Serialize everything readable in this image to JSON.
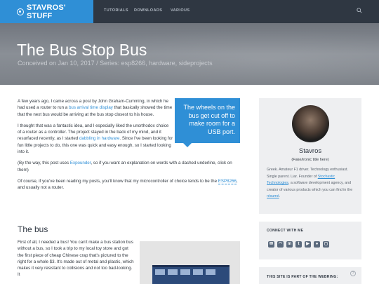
{
  "nav": {
    "brand": "STAVROS' STUFF",
    "items": [
      "TUTORIALS",
      "DOWNLOADS",
      "VARIOUS"
    ]
  },
  "hero": {
    "title": "The Bus Stop Bus",
    "subtitle": "Conceived on Jan 10, 2017 / Series: esp8266, hardware, sideprojects"
  },
  "pullquote": "The wheels on the bus get cut off to make room for a USB port.",
  "article": {
    "p1_a": "A few years ago, I came across a post by John Graham-Cumming, in which he had used a router to run a ",
    "p1_link": "bus arrival time display",
    "p1_b": " that basically showed the time that the next bus would be arriving at the bus stop closest to his house.",
    "p2_a": "I thought that was a fantastic idea, and I especially liked the unorthodox choice of a router as a controller. The project stayed in the back of my mind, and it resurfaced recently, as I started ",
    "p2_link": "dabbling in hardware",
    "p2_b": ". Since I've been looking for fun little projects to do, this one was quick and easy enough, so I started looking into it.",
    "p3_a": "(By the way, this post uses ",
    "p3_link": "Expounder",
    "p3_b": ", so if you want an explanation on words with a dashed underline, click on them)",
    "p4_a": "Of course, if you've been reading my posts, you'll know that my microcontroller of choice tends to be the ",
    "p4_term": "ESP8266",
    "p4_b": ", and usually not a router.",
    "h_bus": "The bus",
    "p5": "First of all, I needed a bus! You can't make a bus station bus without a bus, so I took a trip to my local toy store and got the first piece of cheap Chinese crap that's pictured to the right for a whole $3. It's made out of metal and plastic, which makes it very resistant to collisions and not too bad-looking. It"
  },
  "sidebar": {
    "author_name": "Stavros",
    "author_tag": "(Fake/ironic title here)",
    "bio_a": "Greek. Amateur F1 driver. Technology enthusiast. Single parent. Liar. Founder of ",
    "bio_link": "Stochastic Technologies",
    "bio_b": ", a software development agency, and creator of various products which you can find in the ",
    "bio_link2": "résumé",
    "bio_c": "."
  },
  "connect": {
    "title": "CONNECT WITH ME",
    "icons": [
      "email-icon",
      "rss-icon",
      "mastodon-icon",
      "twitter-icon",
      "youtube-icon",
      "github-icon",
      "instagram-icon"
    ]
  },
  "webring": {
    "title": "THIS SITE IS PART OF THE WEBRING:",
    "help": "?"
  },
  "colors": {
    "brand": "#2f8fd6",
    "navbar": "#2f3742",
    "sidebar_bg": "#eeeff1"
  }
}
